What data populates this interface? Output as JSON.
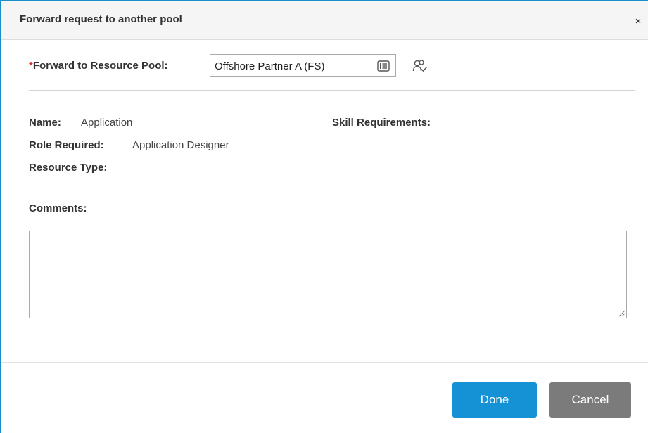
{
  "dialog": {
    "title": "Forward request to another pool",
    "close_label": "×"
  },
  "pool": {
    "required_marker": "*",
    "label": "Forward to Resource Pool:",
    "value": "Offshore Partner A (FS)"
  },
  "details": {
    "name_label": "Name:",
    "name_value": "Application",
    "role_label": "Role Required:",
    "role_value": "Application Designer",
    "resource_type_label": "Resource Type:",
    "resource_type_value": "",
    "skills_label": "Skill Requirements:"
  },
  "comments": {
    "label": "Comments:",
    "value": ""
  },
  "buttons": {
    "done": "Done",
    "cancel": "Cancel"
  },
  "colors": {
    "accent": "#1591d6",
    "cancel": "#7b7b7b",
    "required": "#d9312b"
  },
  "icons": {
    "pool_lookup": "list-icon",
    "pool_people": "person-group-icon",
    "close": "close-icon"
  }
}
